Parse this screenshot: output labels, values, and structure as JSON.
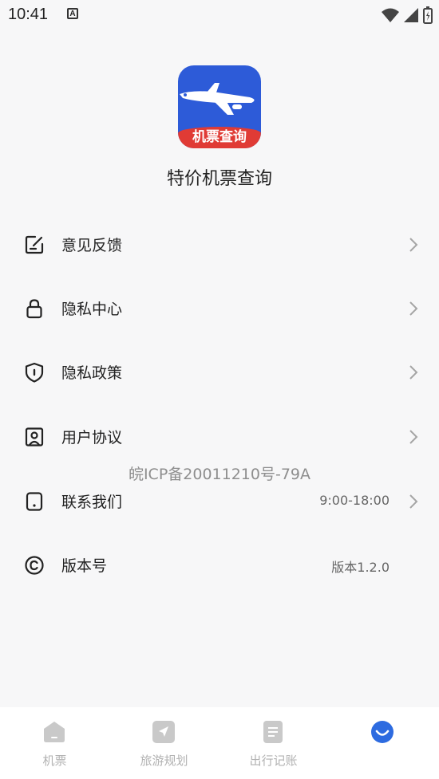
{
  "status_bar": {
    "time": "10:41",
    "notification_letter": "A"
  },
  "header": {
    "logo_text": "机票查询",
    "app_title": "特价机票查询"
  },
  "menu": {
    "items": [
      {
        "label": "意见反馈",
        "icon": "feedback-edit-icon",
        "value": ""
      },
      {
        "label": "隐私中心",
        "icon": "lock-icon",
        "value": ""
      },
      {
        "label": "隐私政策",
        "icon": "shield-icon",
        "value": ""
      },
      {
        "label": "用户协议",
        "icon": "user-agreement-icon",
        "value": ""
      },
      {
        "label": "联系我们",
        "icon": "phone-icon",
        "value": "9:00-18:00"
      },
      {
        "label": "版本号",
        "icon": "copyright-icon",
        "value": "版本1.2.0"
      }
    ]
  },
  "icp": "皖ICP备20011210号-79A",
  "bottom_nav": {
    "items": [
      {
        "label": "机票",
        "icon": "home-icon"
      },
      {
        "label": "旅游规划",
        "icon": "navigation-arrow-icon"
      },
      {
        "label": "出行记账",
        "icon": "notes-icon"
      },
      {
        "label": "",
        "icon": "profile-smile-icon"
      }
    ]
  },
  "colors": {
    "accent": "#2d6be0",
    "inactive": "#c4c4c4",
    "background": "#f7f7f8"
  }
}
